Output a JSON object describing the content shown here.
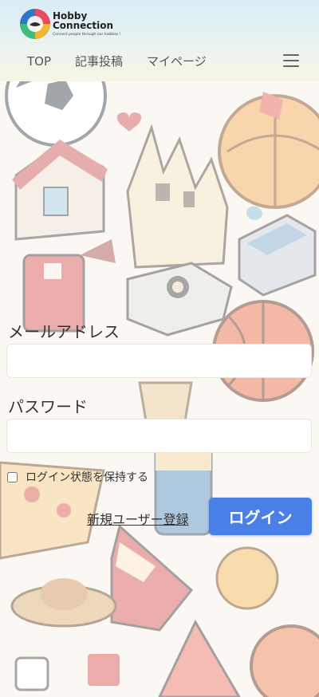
{
  "header": {
    "logo_title": "Hobby Connection",
    "logo_tagline": "Connect people through our hobbies !",
    "nav": [
      {
        "label": "TOP"
      },
      {
        "label": "記事投稿"
      },
      {
        "label": "マイページ"
      }
    ]
  },
  "form": {
    "email_label": "メールアドレス",
    "email_value": "",
    "password_label": "パスワード",
    "password_value": "",
    "remember_label": "ログイン状態を保持する",
    "remember_checked": false,
    "register_link": "新規ユーザー登録",
    "login_button": "ログイン"
  },
  "colors": {
    "primary_button": "#4a80e6",
    "header_gradient_top": "#d9ecf7",
    "header_gradient_bottom": "#f7f5e4"
  },
  "icons": [
    "logo-mark-icon",
    "hamburger-menu-icon"
  ]
}
